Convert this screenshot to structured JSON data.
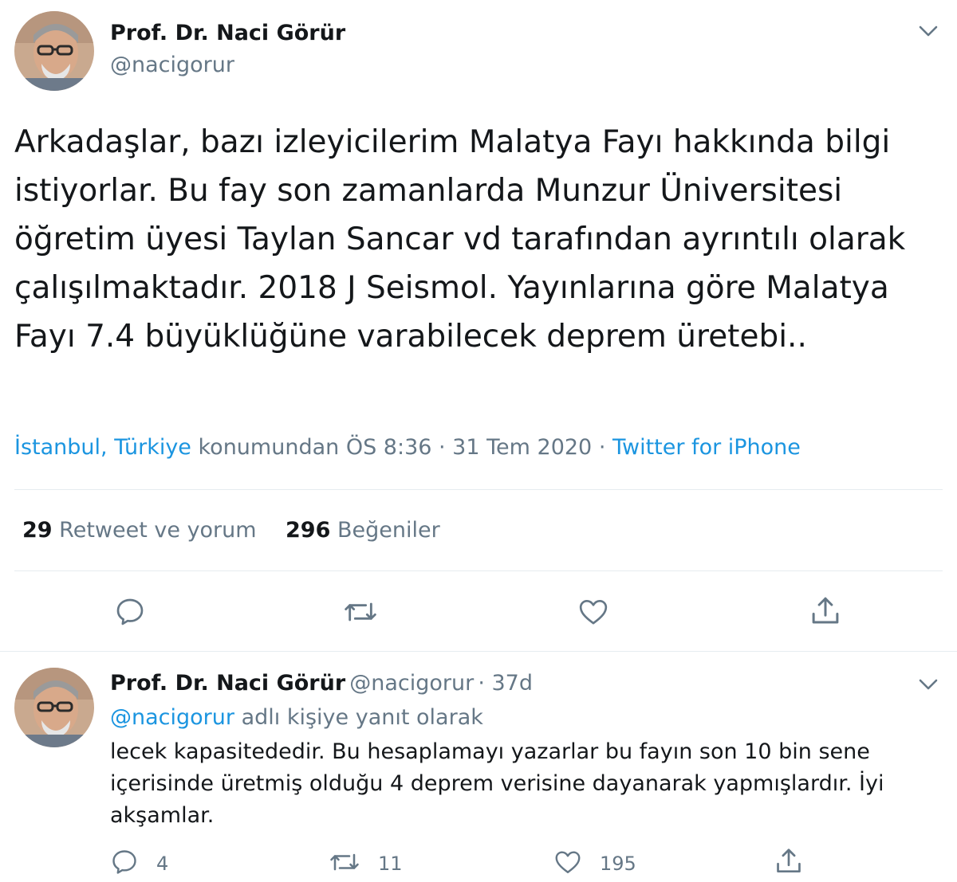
{
  "main_tweet": {
    "author_name": "Prof. Dr. Naci Görür",
    "author_handle": "@nacigorur",
    "text": "Arkadaşlar, bazı izleyicilerim Malatya Fayı hakkında bilgi istiyorlar. Bu fay son zamanlarda Munzur Üniversitesi öğretim üyesi Taylan Sancar vd tarafından ayrıntılı olarak çalışılmaktadır. 2018 J Seismol. Yayınlarına göre Malatya Fayı 7.4 büyüklüğüne varabilecek deprem üretebi..",
    "location": "İstanbul, Türkiye",
    "location_suffix": " konumundan ÖS 8:36 · 31 Tem 2020 · ",
    "source": "Twitter for iPhone",
    "retweets_count": "29",
    "retweets_label": "Retweet ve yorum",
    "likes_count": "296",
    "likes_label": "Beğeniler",
    "actions": {
      "reply_icon": "reply-icon",
      "retweet_icon": "retweet-icon",
      "like_icon": "heart-icon",
      "share_icon": "share-icon"
    }
  },
  "reply_tweet": {
    "author_name": "Prof. Dr. Naci Görür",
    "author_handle": "@nacigorur",
    "time": "· 37d",
    "reply_to_handle": "@nacigorur",
    "reply_to_suffix": " adlı kişiye yanıt olarak",
    "text": "lecek kapasitededir. Bu hesaplamayı yazarlar bu fayın son 10 bin sene içerisinde üretmiş olduğu 4 deprem verisine dayanarak yapmışlardır. İyi akşamlar.",
    "reply_count": "4",
    "retweet_count": "11",
    "like_count": "195"
  },
  "colors": {
    "link": "#1b95e0",
    "secondary_text": "#657786",
    "primary_text": "#14171a",
    "divider": "#e6ecf0"
  }
}
